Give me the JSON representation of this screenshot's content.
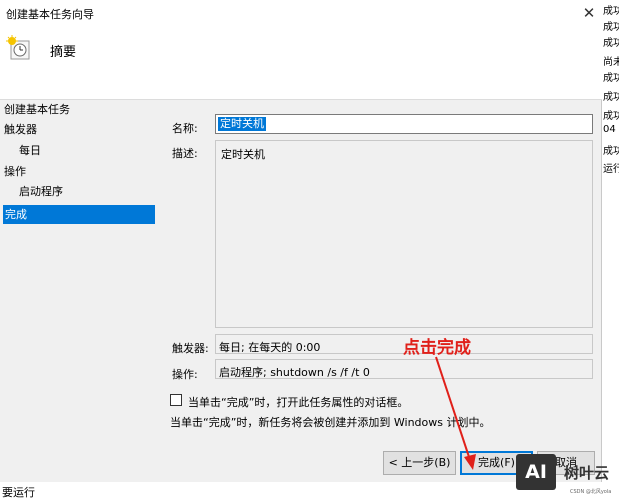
{
  "window": {
    "title": "创建基本任务向导",
    "close_glyph": "✕"
  },
  "header": {
    "title": "摘要"
  },
  "nav": {
    "items": [
      {
        "label": "创建基本任务"
      },
      {
        "label": "触发器"
      },
      {
        "label": "每日"
      },
      {
        "label": "操作"
      },
      {
        "label": "启动程序"
      },
      {
        "label": "完成"
      }
    ]
  },
  "form": {
    "name_label": "名称:",
    "name_value": "定时关机",
    "desc_label": "描述:",
    "desc_value": "定时关机",
    "trigger_label": "触发器:",
    "trigger_value": "每日; 在每天的 0:00",
    "action_label": "操作:",
    "action_value": "启动程序; shutdown /s /f /t 0",
    "checkbox_label": "当单击“完成”时，打开此任务属性的对话框。",
    "note": "当单击“完成”时，新任务将会被创建并添加到 Windows 计划中。"
  },
  "buttons": {
    "back": "< 上一步(B)",
    "finish": "完成(F)",
    "cancel": "取消"
  },
  "annotation": {
    "text": "点击完成",
    "color": "#e0201a"
  },
  "background_window": {
    "rows": [
      "成功",
      "成功",
      "成功",
      "尚未",
      "成功",
      "成功",
      "成功",
      "04",
      "成功",
      "运行"
    ],
    "bottom_text": "要运行"
  },
  "watermark": {
    "logo_text": "AI",
    "brand": "树叶云",
    "caption": "CSDN @北风yola"
  },
  "colors": {
    "selection": "#0078d7",
    "annotation": "#e0201a"
  }
}
